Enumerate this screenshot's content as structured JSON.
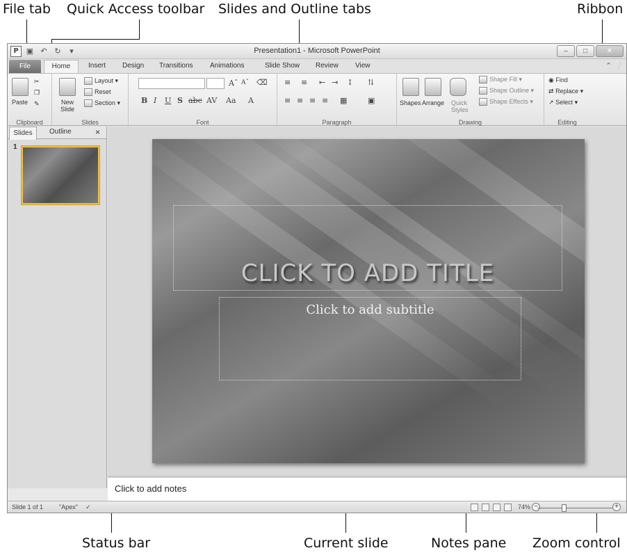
{
  "callouts": {
    "file_tab": "File tab",
    "quick_access": "Quick Access toolbar",
    "slides_outline": "Slides and Outline tabs",
    "ribbon": "Ribbon",
    "status_bar": "Status bar",
    "current_slide": "Current slide",
    "notes_pane": "Notes pane",
    "zoom_control": "Zoom control"
  },
  "window": {
    "title": "Presentation1 - Microsoft PowerPoint",
    "app_icon": "P"
  },
  "tabs": [
    "File",
    "Home",
    "Insert",
    "Design",
    "Transitions",
    "Animations",
    "Slide Show",
    "Review",
    "View"
  ],
  "ribbon": {
    "clipboard": {
      "label": "Clipboard",
      "paste": "Paste"
    },
    "slides": {
      "label": "Slides",
      "new_slide": "New Slide",
      "layout": "Layout",
      "reset": "Reset",
      "section": "Section"
    },
    "font": {
      "label": "Font"
    },
    "paragraph": {
      "label": "Paragraph"
    },
    "drawing": {
      "label": "Drawing",
      "shapes": "Shapes",
      "arrange": "Arrange",
      "quick_styles": "Quick Styles",
      "shape_fill": "Shape Fill",
      "shape_outline": "Shape Outline",
      "shape_effects": "Shape Effects"
    },
    "editing": {
      "label": "Editing",
      "find": "Find",
      "replace": "Replace",
      "select": "Select"
    }
  },
  "left_pane": {
    "tab_slides": "Slides",
    "tab_outline": "Outline",
    "close": "×",
    "thumb_number": "1"
  },
  "slide": {
    "title": "CLICK TO ADD TITLE",
    "subtitle": "Click to add subtitle"
  },
  "notes": {
    "placeholder": "Click to add notes"
  },
  "status": {
    "slide_count": "Slide 1 of 1",
    "theme": "\"Apex\"",
    "zoom": "74%",
    "zoom_level_percent": 74
  }
}
